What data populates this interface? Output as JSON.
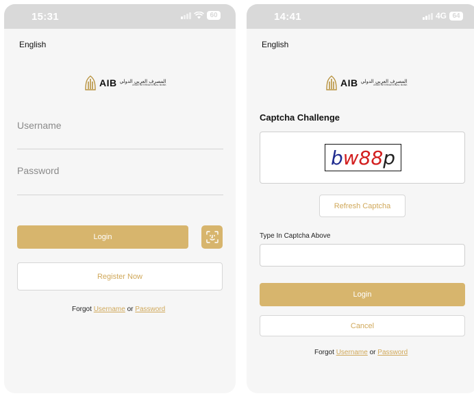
{
  "login_screen": {
    "status": {
      "time": "15:31",
      "battery": "60"
    },
    "language": "English",
    "logo": {
      "text": "AIB",
      "arabic": "المصرف العربي الدولي",
      "english": "ARAB INTERNATIONAL BANK"
    },
    "username_placeholder": "Username",
    "password_placeholder": "Password",
    "login_label": "Login",
    "register_label": "Register Now",
    "forgot": {
      "prefix": "Forgot ",
      "username": "Username",
      "or": " or ",
      "password": "Password"
    }
  },
  "captcha_screen": {
    "status": {
      "time": "14:41",
      "network": "4G",
      "battery": "64"
    },
    "language": "English",
    "logo": {
      "text": "AIB",
      "arabic": "المصرف العربي الدولي",
      "english": "ARAB INTERNATIONAL BANK"
    },
    "captcha_title": "Captcha Challenge",
    "captcha_image": {
      "part1": "b",
      "part2": "w88",
      "part3": "p"
    },
    "refresh_label": "Refresh Captcha",
    "type_label": "Type In Captcha Above",
    "captcha_value": "",
    "login_label": "Login",
    "cancel_label": "Cancel",
    "forgot": {
      "prefix": "Forgot ",
      "username": "Username",
      "or": " or ",
      "password": "Password"
    }
  },
  "colors": {
    "accent": "#d7b56d",
    "link": "#d0a85a",
    "status_bar": "#d9d9d9"
  },
  "icons": [
    "wifi-icon",
    "signal-icon",
    "battery-icon",
    "face-id-icon",
    "aib-logo-icon"
  ]
}
